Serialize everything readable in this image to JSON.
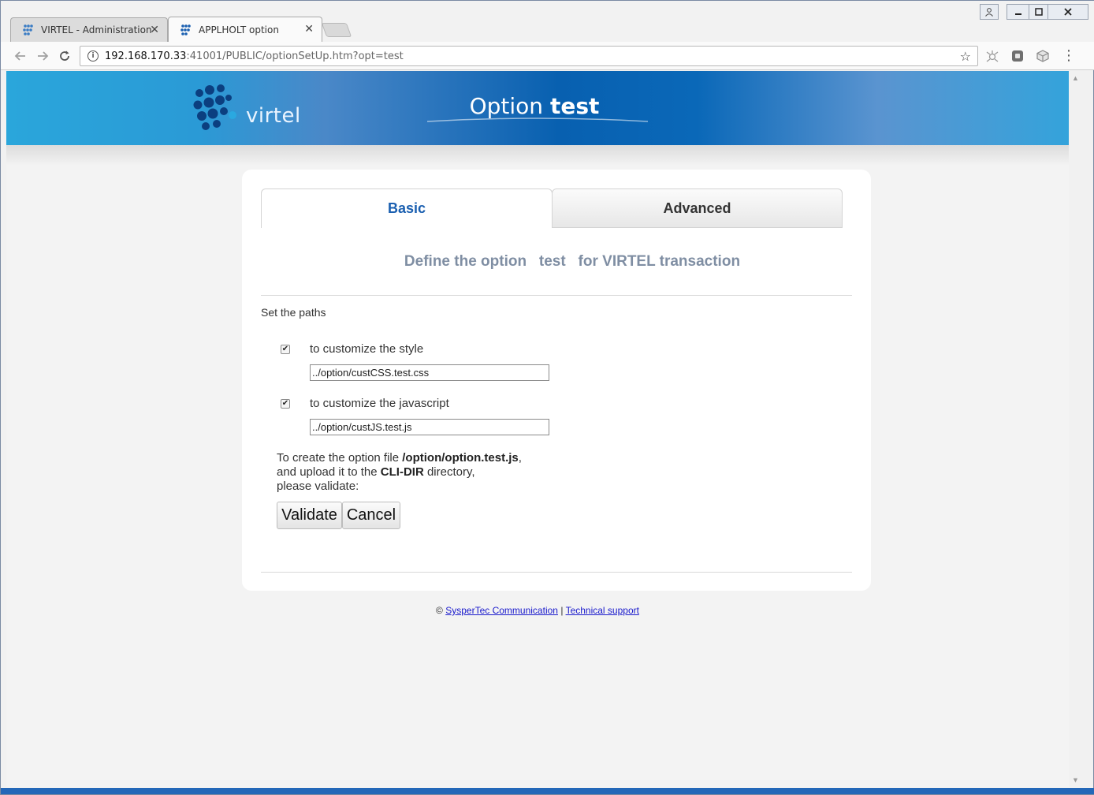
{
  "browser": {
    "tabs": [
      {
        "title": "VIRTEL - Administration",
        "close": "✕"
      },
      {
        "title": "APPLHOLT option",
        "close": "✕"
      }
    ],
    "url": {
      "host": "192.168.170.33",
      "rest": ":41001/PUBLIC/optionSetUp.htm?opt=test"
    },
    "icons": {
      "back": "arrow-left-icon",
      "forward": "arrow-right-icon",
      "reload": "reload-icon",
      "info": "info-icon",
      "star": "star-icon",
      "menu": "menu-dots-icon"
    }
  },
  "banner": {
    "logo_text": "virtel",
    "title_light": "Option ",
    "title_bold": "test"
  },
  "tabs": {
    "basic": "Basic",
    "advanced": "Advanced"
  },
  "form": {
    "heading": "Define the option   test   for VIRTEL transaction",
    "paths_label": "Set the paths",
    "style": {
      "checked": true,
      "label": "to customize the style",
      "value": "../option/custCSS.test.css"
    },
    "javascript": {
      "checked": true,
      "label": "to customize the javascript",
      "value": "../option/custJS.test.js"
    },
    "info": {
      "line1_prefix": "To create the option file ",
      "line1_bold": "/option/option.test.js",
      "line1_suffix": ",",
      "line2_prefix": "and upload it to the ",
      "line2_bold": "CLI-DIR",
      "line2_suffix": " directory,",
      "line3": "please validate:"
    },
    "buttons": {
      "validate": "Validate",
      "cancel": "Cancel"
    }
  },
  "footer": {
    "copyright": "©",
    "company_link": "SysperTec Communication",
    "separator": "|",
    "support_link": "Technical support"
  },
  "colors": {
    "accent": "#1a5fb0",
    "banner_dark": "#0860b0",
    "banner_light": "#2aa6db",
    "heading": "#7f8ea3"
  }
}
